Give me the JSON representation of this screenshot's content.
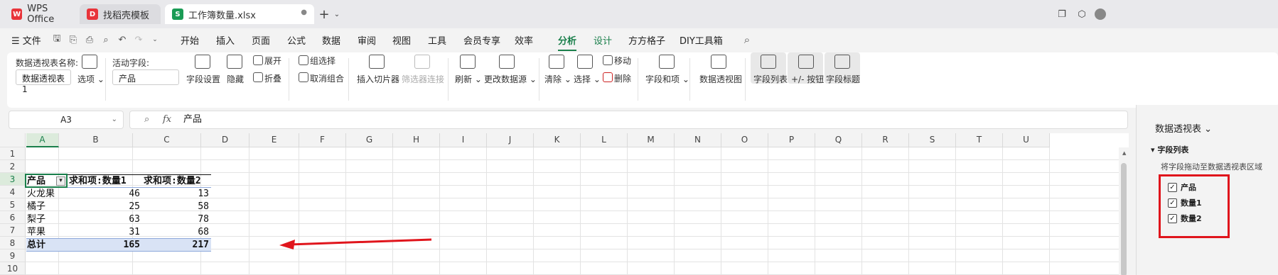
{
  "tabs": {
    "wps": "WPS Office",
    "template": "找稻壳模板",
    "file": "工作簿数量.xlsx"
  },
  "menu": {
    "file": "文件",
    "items": [
      "开始",
      "插入",
      "页面",
      "公式",
      "数据",
      "审阅",
      "视图",
      "工具",
      "会员专享",
      "效率",
      "分析",
      "设计",
      "方方格子",
      "DIY工具箱"
    ],
    "active": "分析"
  },
  "ribbon": {
    "pivot_name_label": "数据透视表名称:",
    "pivot_name_value": "数据透视表1",
    "options": "选项",
    "active_field_label": "活动字段:",
    "active_field_value": "产品",
    "field_settings": "字段设置",
    "hide": "隐藏",
    "expand": "展开",
    "collapse": "折叠",
    "group_select": "组选择",
    "ungroup": "取消组合",
    "insert_slicer": "插入切片器",
    "filter_connections": "筛选器连接",
    "refresh": "刷新",
    "change_source": "更改数据源",
    "clear": "清除",
    "select": "选择",
    "move": "移动",
    "delete": "删除",
    "fields_items": "字段和项",
    "pivot_chart": "数据透视图",
    "field_list": "字段列表",
    "plus_minus": "+/- 按钮",
    "field_headers": "字段标题"
  },
  "formula_bar": {
    "name_box": "A3",
    "fx": "fx",
    "content": "产品"
  },
  "columns": [
    "A",
    "B",
    "C",
    "D",
    "E",
    "F",
    "G",
    "H",
    "I",
    "J",
    "K",
    "L",
    "M",
    "N",
    "O",
    "P",
    "Q",
    "R",
    "S",
    "T",
    "U"
  ],
  "rows": [
    "1",
    "2",
    "3",
    "4",
    "5",
    "6",
    "7",
    "8",
    "9",
    "10"
  ],
  "pivot": {
    "header": [
      "产品",
      "求和项:数量1",
      "求和项:数量2"
    ],
    "rows": [
      [
        "火龙果",
        "46",
        "13"
      ],
      [
        "橘子",
        "25",
        "58"
      ],
      [
        "梨子",
        "63",
        "78"
      ],
      [
        "苹果",
        "31",
        "68"
      ]
    ],
    "total": [
      "总计",
      "165",
      "217"
    ]
  },
  "panel": {
    "title": "数据透视表",
    "section": "字段列表",
    "hint": "将字段拖动至数据透视表区域",
    "fields": [
      "产品",
      "数量1",
      "数量2"
    ]
  },
  "colors": {
    "accent": "#1a7f4b",
    "annotation": "#e0151c"
  }
}
